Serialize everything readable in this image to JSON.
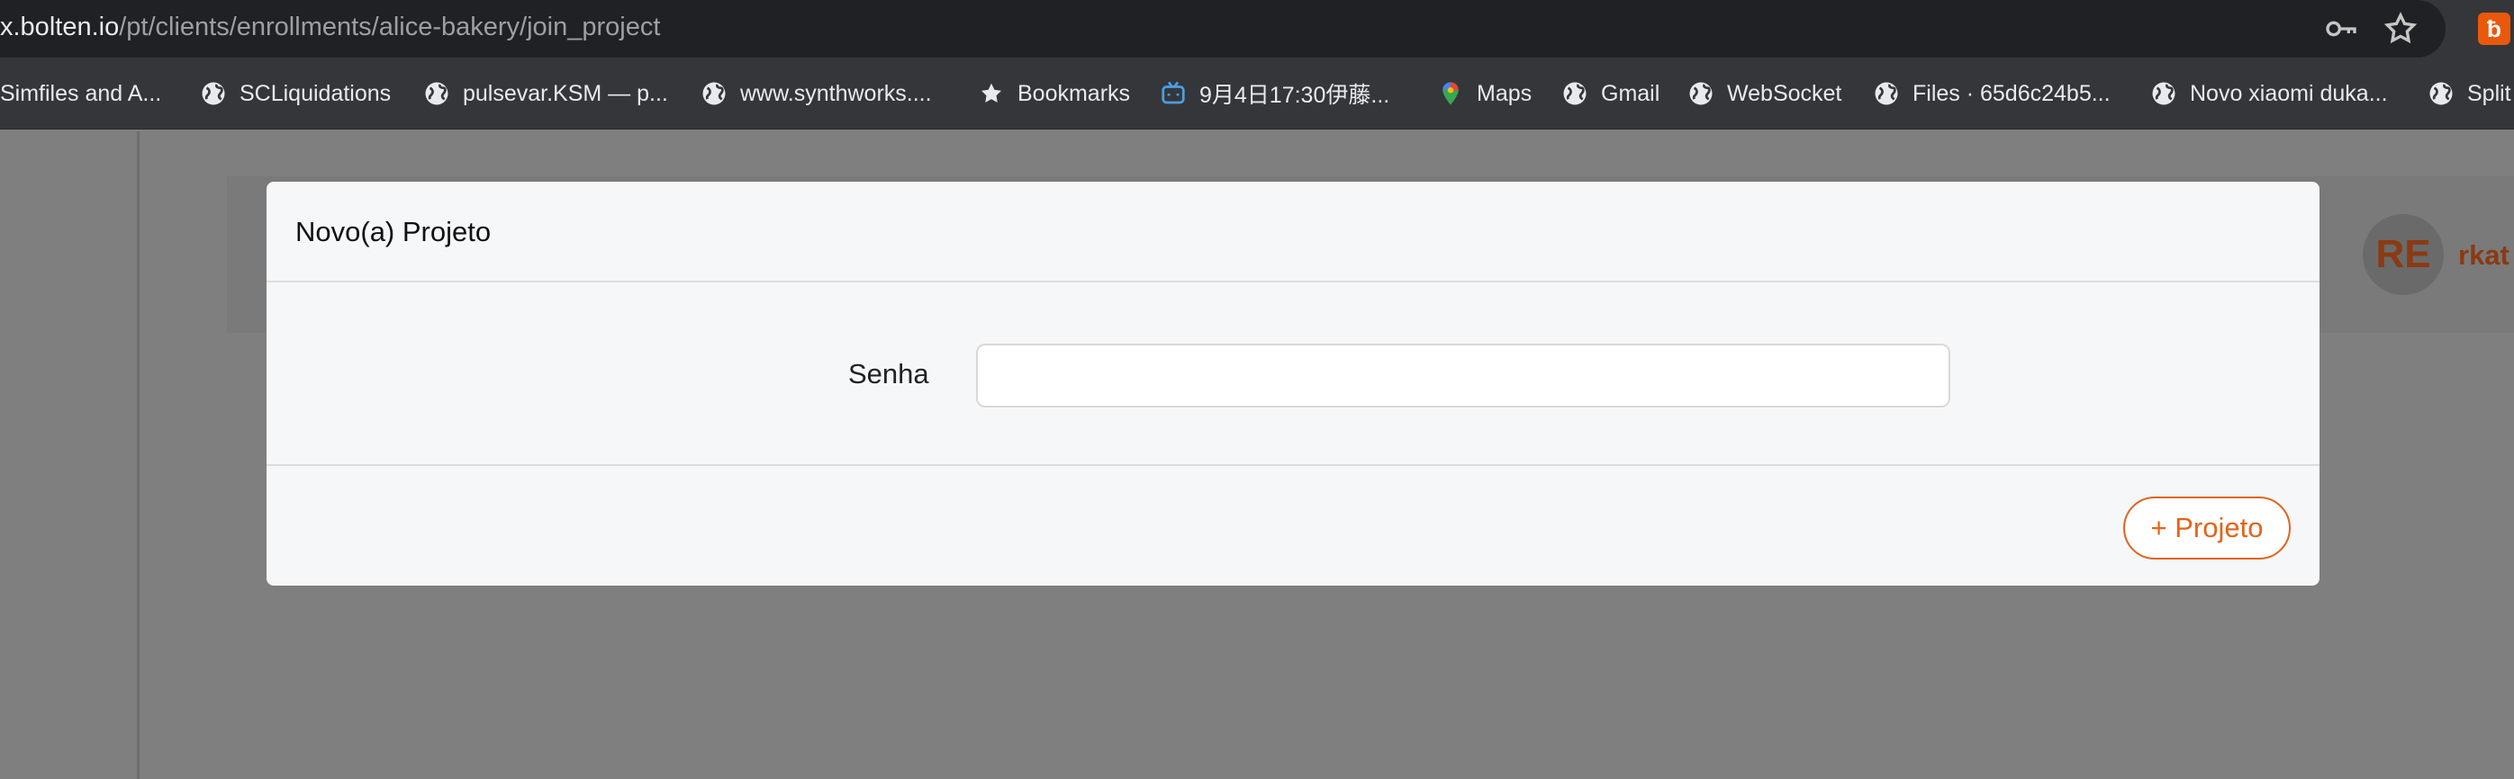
{
  "browser": {
    "url_host": "x.bolten.io",
    "url_path": "/pt/clients/enrollments/alice-bakery/join_project",
    "icons": [
      "key-icon",
      "star-icon",
      "bolten-extension-icon"
    ],
    "extension_glyph": "ƀ"
  },
  "bookmarks": [
    {
      "label": "Simfiles and A...",
      "icon": "none"
    },
    {
      "label": "SCLiquidations",
      "icon": "globe-icon"
    },
    {
      "label": "pulsevar.KSM — p...",
      "icon": "globe-icon"
    },
    {
      "label": "www.synthworks....",
      "icon": "globe-icon"
    },
    {
      "label": "Bookmarks",
      "icon": "star-icon"
    },
    {
      "label": "9月4日17:30伊藤...",
      "icon": "bilibili-tv-icon"
    },
    {
      "label": "Maps",
      "icon": "map-pin-icon"
    },
    {
      "label": "Gmail",
      "icon": "globe-icon"
    },
    {
      "label": "WebSocket",
      "icon": "globe-icon"
    },
    {
      "label": "Files · 65d6c24b5...",
      "icon": "globe-icon"
    },
    {
      "label": "Novo xiaomi duka...",
      "icon": "globe-icon"
    },
    {
      "label": "Split",
      "icon": "globe-icon"
    }
  ],
  "user": {
    "initials": "RE",
    "name_partial": "rkat"
  },
  "colors": {
    "accent": "#e1641c",
    "overlay": "#7f7f7f",
    "modal_bg": "#f6f7f9"
  },
  "modal": {
    "title": "Novo(a) Projeto",
    "password_label": "Senha",
    "password_value": "",
    "submit_label": "+ Projeto"
  }
}
